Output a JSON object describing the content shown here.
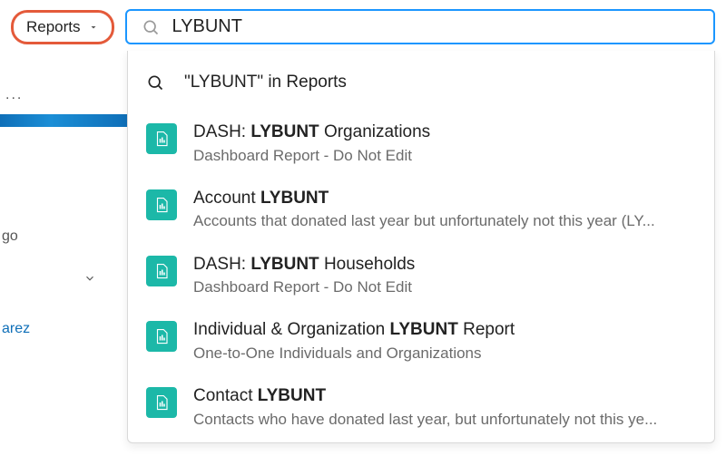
{
  "scope": {
    "label": "Reports"
  },
  "search": {
    "value": "LYBUNT"
  },
  "searchIn": {
    "prefix": "\"",
    "term": "LYBUNT",
    "suffix": "\" in Reports"
  },
  "results": [
    {
      "title_pre": "DASH: ",
      "title_bold": "LYBUNT",
      "title_post": " Organizations",
      "sub": "Dashboard Report - Do Not Edit"
    },
    {
      "title_pre": "Account ",
      "title_bold": "LYBUNT",
      "title_post": "",
      "sub": "Accounts that donated last year but unfortunately not this year (LY..."
    },
    {
      "title_pre": "DASH: ",
      "title_bold": "LYBUNT",
      "title_post": " Households",
      "sub": "Dashboard Report - Do Not Edit"
    },
    {
      "title_pre": "Individual & Organization ",
      "title_bold": "LYBUNT",
      "title_post": " Report",
      "sub": "One-to-One Individuals and Organizations"
    },
    {
      "title_pre": "Contact ",
      "title_bold": "LYBUNT",
      "title_post": "",
      "sub": "Contacts who have donated last year, but unfortunately not this ye..."
    }
  ],
  "bg": {
    "dots": "...",
    "go": "go",
    "link": "arez"
  }
}
